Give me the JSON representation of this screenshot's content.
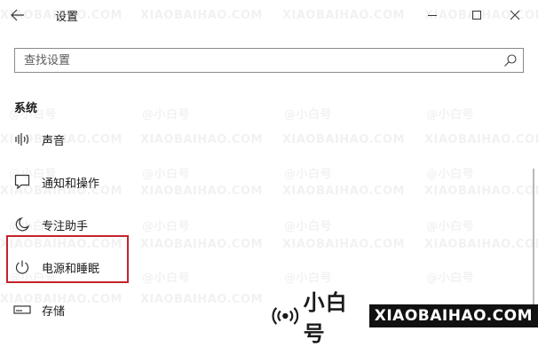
{
  "window": {
    "title": "设置"
  },
  "search": {
    "placeholder": "查找设置"
  },
  "section": {
    "heading": "系统"
  },
  "nav_items": [
    {
      "label": "声音",
      "icon": "speaker-icon"
    },
    {
      "label": "通知和操作",
      "icon": "notification-icon"
    },
    {
      "label": "专注助手",
      "icon": "moon-icon"
    },
    {
      "label": "电源和睡眠",
      "icon": "power-icon"
    },
    {
      "label": "存储",
      "icon": "storage-icon"
    }
  ],
  "watermark": {
    "brand_cn": "小白号",
    "brand_en": "XIAOBAIHAO.COM",
    "tile_cn": "@小白号",
    "tile_en": "XIAOBAIHAO.COM"
  },
  "colors": {
    "highlight": "#c4232b"
  }
}
